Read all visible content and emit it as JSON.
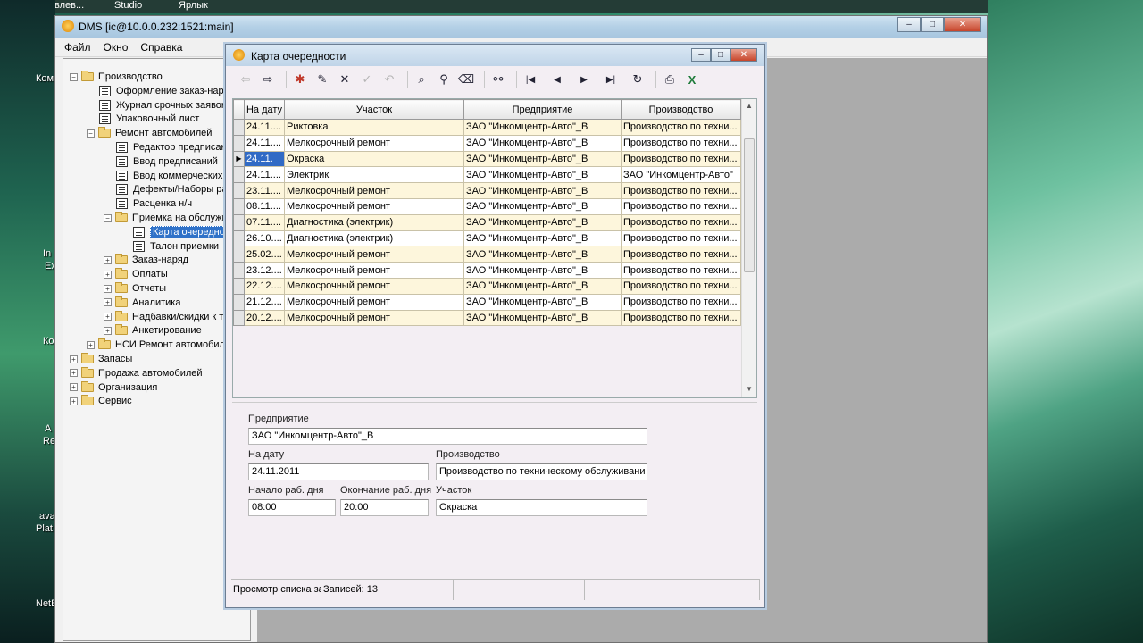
{
  "taskbar": {
    "items": [
      "Яковлев...",
      "Studio",
      "Ярлык"
    ]
  },
  "desktop": {
    "labels": [
      "Комп",
      "In",
      "Ex",
      "Ко",
      "А",
      "Re",
      "ava",
      "Plat",
      "NetB"
    ]
  },
  "window": {
    "title": "DMS [ic@10.0.0.232:1521:main]",
    "min": "–",
    "max": "□",
    "close": "✕"
  },
  "menu": {
    "items": [
      "Файл",
      "Окно",
      "Справка"
    ]
  },
  "tree": {
    "close": "×",
    "items": [
      {
        "label": "Производство",
        "type": "folder",
        "pm": "−"
      },
      {
        "label": "Оформление заказ-наряда",
        "type": "doc"
      },
      {
        "label": "Журнал срочных заявок",
        "type": "doc"
      },
      {
        "label": "Упаковочный лист",
        "type": "doc"
      },
      {
        "label": "Ремонт автомобилей",
        "type": "folder",
        "pm": "−"
      },
      {
        "label": "Редактор предписаний",
        "type": "doc"
      },
      {
        "label": "Ввод предписаний",
        "type": "doc"
      },
      {
        "label": "Ввод коммерческих работ",
        "type": "doc"
      },
      {
        "label": "Дефекты/Наборы работ",
        "type": "doc"
      },
      {
        "label": "Расценка н/ч",
        "type": "doc"
      },
      {
        "label": "Приемка на обслуживани",
        "type": "folder",
        "pm": "−"
      },
      {
        "label": "Карта очередности",
        "type": "doc",
        "selected": true
      },
      {
        "label": "Талон приемки",
        "type": "doc"
      },
      {
        "label": "Заказ-наряд",
        "type": "folder",
        "pm": "+"
      },
      {
        "label": "Оплаты",
        "type": "folder",
        "pm": "+"
      },
      {
        "label": "Отчеты",
        "type": "folder",
        "pm": "+"
      },
      {
        "label": "Аналитика",
        "type": "folder",
        "pm": "+"
      },
      {
        "label": "Надбавки/скидки к трудо",
        "type": "folder",
        "pm": "+"
      },
      {
        "label": "Анкетирование",
        "type": "folder",
        "pm": "+"
      },
      {
        "label": "НСИ Ремонт автомобилей",
        "type": "folder",
        "pm": "+"
      },
      {
        "label": "Запасы",
        "type": "folder",
        "pm": "+"
      },
      {
        "label": "Продажа автомобилей",
        "type": "folder",
        "pm": "+"
      },
      {
        "label": "Организация",
        "type": "folder",
        "pm": "+"
      },
      {
        "label": "Сервис",
        "type": "folder",
        "pm": "+"
      }
    ]
  },
  "child": {
    "title": "Карта очередности",
    "toolbar": [
      "⇦",
      "⇨",
      "✱",
      "✎",
      "✕",
      "✓",
      "↶",
      "⌕",
      "⚲",
      "⌫",
      "⚯",
      "|◀",
      "◀",
      "▶",
      "▶|",
      "↻",
      "⎙",
      "X"
    ],
    "grid": {
      "headers": [
        "На дату",
        "Участок",
        "Предприятие",
        "Производство"
      ],
      "rows": [
        [
          "24.11....",
          "Риктовка",
          "ЗАО \"Инкомцентр-Авто\"_В",
          "Производство по техни..."
        ],
        [
          "24.11....",
          "Мелкосрочный ремонт",
          "ЗАО \"Инкомцентр-Авто\"_В",
          "Производство по техни..."
        ],
        [
          "24.11.",
          "Окраска",
          "ЗАО \"Инкомцентр-Авто\"_В",
          "Производство по техни..."
        ],
        [
          "24.11....",
          "Электрик",
          "ЗАО \"Инкомцентр-Авто\"_В",
          "ЗАО \"Инкомцентр-Авто\""
        ],
        [
          "23.11....",
          "Мелкосрочный ремонт",
          "ЗАО \"Инкомцентр-Авто\"_В",
          "Производство по техни..."
        ],
        [
          "08.11....",
          "Мелкосрочный ремонт",
          "ЗАО \"Инкомцентр-Авто\"_В",
          "Производство по техни..."
        ],
        [
          "07.11....",
          "Диагностика (электрик)",
          "ЗАО \"Инкомцентр-Авто\"_В",
          "Производство по техни..."
        ],
        [
          "26.10....",
          "Диагностика (электрик)",
          "ЗАО \"Инкомцентр-Авто\"_В",
          "Производство по техни..."
        ],
        [
          "25.02....",
          "Мелкосрочный ремонт",
          "ЗАО \"Инкомцентр-Авто\"_В",
          "Производство по техни..."
        ],
        [
          "23.12....",
          "Мелкосрочный ремонт",
          "ЗАО \"Инкомцентр-Авто\"_В",
          "Производство по техни..."
        ],
        [
          "22.12....",
          "Мелкосрочный ремонт",
          "ЗАО \"Инкомцентр-Авто\"_В",
          "Производство по техни..."
        ],
        [
          "21.12....",
          "Мелкосрочный ремонт",
          "ЗАО \"Инкомцентр-Авто\"_В",
          "Производство по техни..."
        ],
        [
          "20.12....",
          "Мелкосрочный ремонт",
          "ЗАО \"Инкомцентр-Авто\"_В",
          "Производство по техни..."
        ]
      ],
      "current_row": 2
    },
    "detail": {
      "enterprise_label": "Предприятие",
      "enterprise_value": "ЗАО \"Инкомцентр-Авто\"_В",
      "date_label": "На дату",
      "date_value": "24.11.2011",
      "production_label": "Производство",
      "production_value": "Производство по техническому обслуживани",
      "start_label": "Начало раб. дня",
      "start_value": "08:00",
      "end_label": "Окончание раб. дня",
      "end_value": "20:00",
      "section_label": "Участок",
      "section_value": "Окраска"
    },
    "status": {
      "mode": "Просмотр списка за",
      "records": "Записей: 13"
    }
  }
}
